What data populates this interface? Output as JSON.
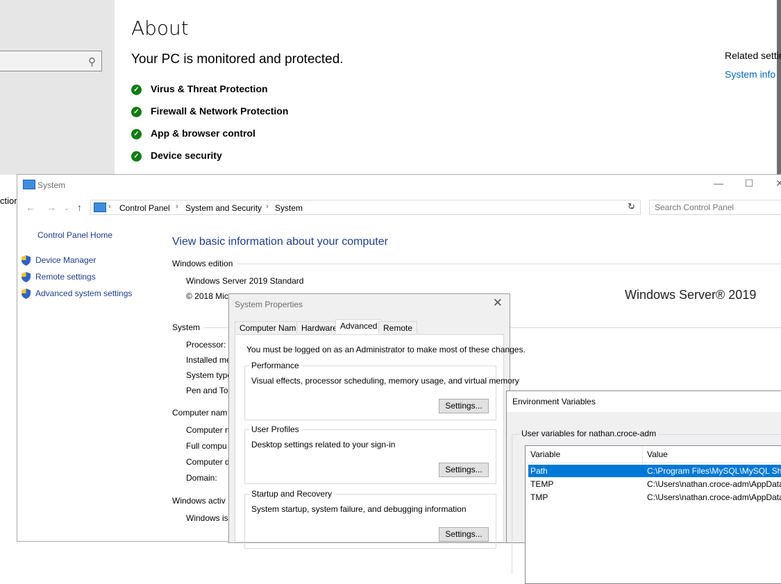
{
  "settings": {
    "page_title": "About",
    "status_heading": "Your PC is monitored and protected.",
    "protection_items": [
      {
        "label": "Virus & Threat Protection"
      },
      {
        "label": "Firewall & Network Protection"
      },
      {
        "label": "App & browser control"
      },
      {
        "label": "Device security"
      }
    ],
    "related_title": "Related settir",
    "related_link": "System info",
    "left_cut_text": "ction",
    "status_color": "#107c10",
    "link_color": "#0067c0"
  },
  "system_window": {
    "title": "System",
    "breadcrumbs": [
      "Control Panel",
      "System and Security",
      "System"
    ],
    "search_placeholder": "Search Control Panel",
    "sidebar": {
      "home": "Control Panel Home",
      "links": [
        "Device Manager",
        "Remote settings",
        "Advanced system settings"
      ]
    },
    "heading": "View basic information about your computer",
    "edition": {
      "section_title": "Windows edition",
      "name": "Windows Server 2019 Standard",
      "copyright": "© 2018 Mic"
    },
    "brand": "Windows Server® 2019",
    "system_section": {
      "title": "System",
      "labels": [
        "Processor:",
        "Installed me",
        "System type",
        "Pen and Tou"
      ]
    },
    "computer_section": {
      "title": "Computer nam",
      "labels": [
        "Computer n",
        "Full compu",
        "Computer d",
        "Domain:"
      ]
    },
    "activation_section": {
      "title": "Windows activ",
      "labels": [
        "Windows is"
      ]
    }
  },
  "system_properties": {
    "title": "System Properties",
    "tabs": [
      "Computer Name",
      "Hardware",
      "Advanced",
      "Remote"
    ],
    "active_tab": "Advanced",
    "admin_note": "You must be logged on as an Administrator to make most of these changes.",
    "groups": [
      {
        "title": "Performance",
        "desc": "Visual effects, processor scheduling, memory usage, and virtual memory",
        "button": "Settings..."
      },
      {
        "title": "User Profiles",
        "desc": "Desktop settings related to your sign-in",
        "button": "Settings..."
      },
      {
        "title": "Startup and Recovery",
        "desc": "System startup, system failure, and debugging information",
        "button": "Settings..."
      }
    ]
  },
  "environment_variables": {
    "title": "Environment Variables",
    "group_title": "User variables for nathan.croce-adm",
    "columns": [
      "Variable",
      "Value"
    ],
    "rows": [
      {
        "variable": "Path",
        "value": "C:\\Program Files\\MySQL\\MySQL She",
        "selected": true
      },
      {
        "variable": "TEMP",
        "value": "C:\\Users\\nathan.croce-adm\\AppData",
        "selected": false
      },
      {
        "variable": "TMP",
        "value": "C:\\Users\\nathan.croce-adm\\AppData",
        "selected": false
      }
    ],
    "selection_color": "#0078d7"
  }
}
